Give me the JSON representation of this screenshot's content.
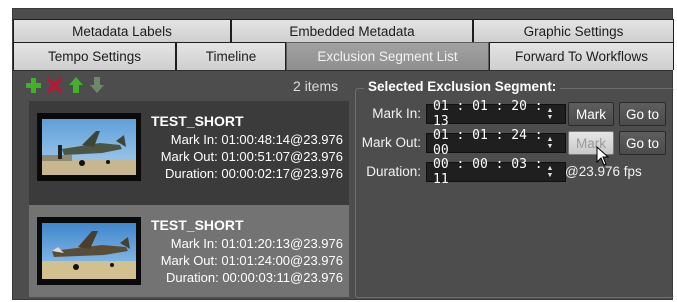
{
  "tabs": {
    "row1": [
      "Metadata Labels",
      "Embedded Metadata",
      "Graphic Settings"
    ],
    "row2": [
      "Tempo Settings",
      "Timeline",
      "Exclusion Segment List",
      "Forward To Workflows"
    ],
    "active": "Exclusion Segment List"
  },
  "toolbar": {
    "add_icon": "plus-icon",
    "delete_icon": "x-icon",
    "move_up_icon": "arrow-up-icon",
    "move_down_icon": "arrow-down-icon"
  },
  "list": {
    "count": "2 items",
    "items": [
      {
        "name": "TEST_SHORT",
        "mark_in": "Mark In:  01:00:48:14@23.976",
        "mark_out": "Mark Out:  01:00:51:07@23.976",
        "duration": "Duration:  00:00:02:17@23.976"
      },
      {
        "name": "TEST_SHORT",
        "mark_in": "Mark In:  01:01:20:13@23.976",
        "mark_out": "Mark Out:  01:01:24:00@23.976",
        "duration": "Duration:  00:00:03:11@23.976"
      }
    ]
  },
  "selected": {
    "title": "Selected Exclusion Segment:",
    "mark_in_label": "Mark In:",
    "mark_in_value": "01 : 01 : 20 : 13",
    "mark_out_label": "Mark Out:",
    "mark_out_value": "01 : 01 : 24 : 00",
    "duration_label": "Duration:",
    "duration_value": "00 : 00 : 03 : 11",
    "fps": "@23.976 fps",
    "mark_button": "Mark",
    "goto_button": "Go to"
  },
  "colors": {
    "panel_bg": "#4d4d4d",
    "list_bg": "#3b3b3b",
    "selected_item_bg": "#737373",
    "add_green": "#4caf50",
    "delete_red": "#c62828"
  }
}
